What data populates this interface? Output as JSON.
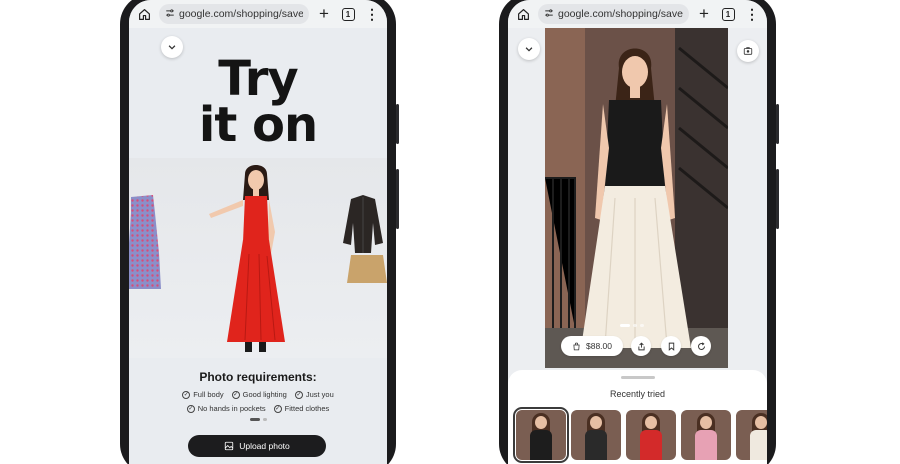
{
  "browser": {
    "url": "google.com/shopping/save",
    "tab_count": "1",
    "icons": [
      "home-icon",
      "site-settings-icon",
      "new-tab-icon",
      "tab-switcher-icon",
      "more-menu-icon"
    ]
  },
  "left_screen": {
    "title_line1": "Try",
    "title_line2": "it on",
    "requirements_title": "Photo requirements:",
    "requirements_row1": [
      "Full body",
      "Good lighting",
      "Just you"
    ],
    "requirements_row2": [
      "No hands in pockets",
      "Fitted clothes"
    ],
    "upload_label": "Upload photo",
    "colors": {
      "dress": "#e0241c",
      "button": "#1c1c1e"
    }
  },
  "right_screen": {
    "price": "$88.00",
    "recently_tried_label": "Recently tried",
    "thumbnails": [
      {
        "outfit": "black top, white skirt",
        "color": "#1d1d1d",
        "selected": true
      },
      {
        "outfit": "black top",
        "color": "#2a2a2a",
        "selected": false
      },
      {
        "outfit": "red dress",
        "color": "#d32a2a",
        "selected": false
      },
      {
        "outfit": "pink dress",
        "color": "#e7a1b4",
        "selected": false
      },
      {
        "outfit": "white dress",
        "color": "#efe9df",
        "selected": false
      }
    ]
  }
}
